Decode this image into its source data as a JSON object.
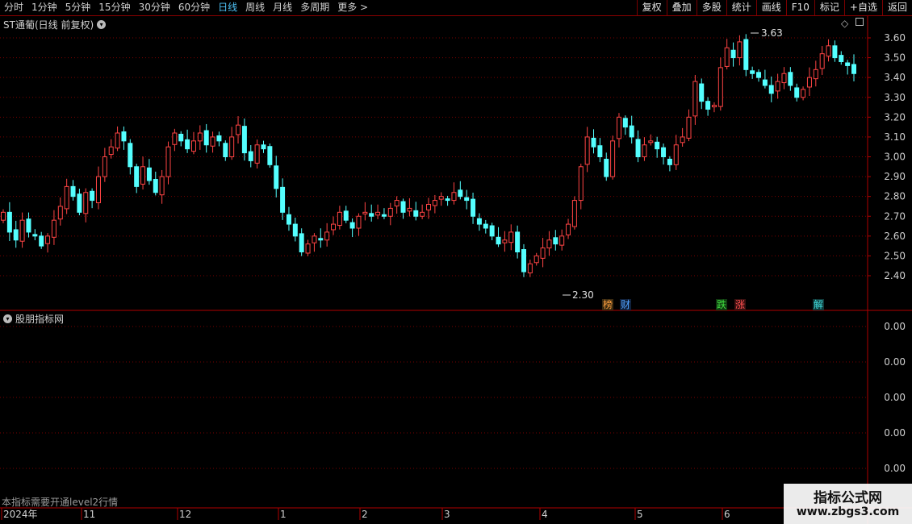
{
  "toolbar": {
    "periods": [
      "分时",
      "1分钟",
      "5分钟",
      "15分钟",
      "30分钟",
      "60分钟",
      "日线",
      "周线",
      "月线",
      "多周期",
      "更多 >"
    ],
    "active_period": "日线",
    "buttons": [
      "复权",
      "叠加",
      "多股",
      "统计",
      "画线",
      "F10",
      "标记",
      "+自选",
      "返回"
    ]
  },
  "main_panel": {
    "title": "ST通葡(日线 前复权)",
    "price_labels": [
      "3.60",
      "3.50",
      "3.40",
      "3.30",
      "3.20",
      "3.10",
      "3.00",
      "2.90",
      "2.80",
      "2.70",
      "2.60",
      "2.50",
      "2.40"
    ],
    "high_marker": "3.63",
    "low_marker": "2.30",
    "event_tags": [
      {
        "text": "榜",
        "color": "#ffa040",
        "bg": "#3a2a10"
      },
      {
        "text": "财",
        "color": "#4fa3ff",
        "bg": "#10203a"
      },
      {
        "text": "跌",
        "color": "#40e040",
        "bg": "#103a10"
      },
      {
        "text": "涨",
        "color": "#ff5050",
        "bg": "#3a1010"
      },
      {
        "text": "解",
        "color": "#40e0e0",
        "bg": "#103a3a"
      }
    ]
  },
  "indicator_panel": {
    "title": "股朋指标网",
    "value_labels": [
      "0.00",
      "0.00",
      "0.00",
      "0.00",
      "0.00"
    ],
    "note": "本指标需要开通level2行情"
  },
  "date_axis": {
    "labels": [
      "2024年",
      "11",
      "12",
      "1",
      "2",
      "3",
      "4",
      "5",
      "6"
    ]
  },
  "watermark": {
    "line1": "指标公式网",
    "line2": "www.zbgs3.com"
  },
  "colors": {
    "up": "#ff4444",
    "down": "#54ffff",
    "grid": "#7a0000",
    "border": "#b00000"
  },
  "chart_data": {
    "type": "candlestick",
    "ylim": [
      2.3,
      3.63
    ],
    "closes": [
      2.72,
      2.62,
      2.58,
      2.68,
      2.62,
      2.6,
      2.55,
      2.6,
      2.68,
      2.75,
      2.85,
      2.8,
      2.72,
      2.82,
      2.78,
      2.9,
      3.0,
      3.05,
      3.12,
      3.08,
      2.95,
      2.85,
      2.95,
      2.88,
      2.82,
      2.9,
      3.05,
      3.12,
      3.08,
      3.04,
      3.08,
      3.12,
      3.06,
      3.1,
      3.08,
      3.0,
      3.1,
      3.16,
      3.02,
      2.98,
      3.06,
      3.04,
      2.96,
      2.84,
      2.72,
      2.66,
      2.6,
      2.52,
      2.56,
      2.6,
      2.58,
      2.62,
      2.66,
      2.72,
      2.68,
      2.64,
      2.7,
      2.72,
      2.7,
      2.72,
      2.7,
      2.74,
      2.78,
      2.72,
      2.74,
      2.7,
      2.72,
      2.76,
      2.78,
      2.8,
      2.78,
      2.82,
      2.8,
      2.78,
      2.7,
      2.66,
      2.64,
      2.6,
      2.56,
      2.58,
      2.62,
      2.52,
      2.42,
      2.46,
      2.5,
      2.54,
      2.58,
      2.56,
      2.6,
      2.66,
      2.78,
      2.95,
      3.1,
      3.05,
      3.0,
      2.9,
      3.08,
      3.2,
      3.15,
      3.1,
      3.0,
      3.06,
      3.08,
      3.04,
      3.0,
      2.96,
      3.06,
      3.1,
      3.2,
      3.38,
      3.28,
      3.24,
      3.26,
      3.45,
      3.55,
      3.5,
      3.58,
      3.44,
      3.42,
      3.4,
      3.36,
      3.32,
      3.38,
      3.42,
      3.36,
      3.3,
      3.34,
      3.4,
      3.44,
      3.52,
      3.56,
      3.5,
      3.48,
      3.46,
      3.42
    ]
  }
}
